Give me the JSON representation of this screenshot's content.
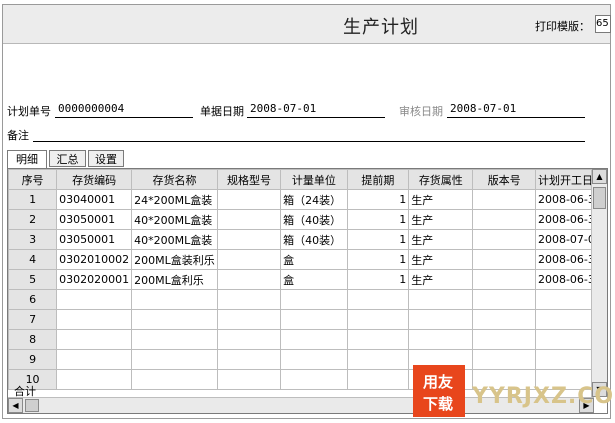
{
  "title": "生产计划",
  "print_template": {
    "label": "打印模版：",
    "value": "65"
  },
  "header": {
    "plan_no_label": "计划单号",
    "plan_no_value": "0000000004",
    "doc_date_label": "单据日期",
    "doc_date_value": "2008-07-01",
    "audit_date_label": "审核日期",
    "audit_date_value": "2008-07-01",
    "remark_label": "备注"
  },
  "tabs": [
    "明细",
    "汇总",
    "设置"
  ],
  "columns": [
    "序号",
    "存货编码",
    "存货名称",
    "规格型号",
    "计量单位",
    "提前期",
    "存货属性",
    "版本号",
    "计划开工日期"
  ],
  "rows": [
    {
      "no": "1",
      "code": "03040001",
      "name": "24*200ML盒装",
      "spec": "",
      "unit": "箱（24装）",
      "lead": "1",
      "attr": "生产",
      "ver": "",
      "date": "2008-06-30"
    },
    {
      "no": "2",
      "code": "03050001",
      "name": "40*200ML盒装",
      "spec": "",
      "unit": "箱（40装）",
      "lead": "1",
      "attr": "生产",
      "ver": "",
      "date": "2008-06-30"
    },
    {
      "no": "3",
      "code": "03050001",
      "name": "40*200ML盒装",
      "spec": "",
      "unit": "箱（40装）",
      "lead": "1",
      "attr": "生产",
      "ver": "",
      "date": "2008-07-01"
    },
    {
      "no": "4",
      "code": "0302010002",
      "name": "200ML盒装利乐",
      "spec": "",
      "unit": "盒",
      "lead": "1",
      "attr": "生产",
      "ver": "",
      "date": "2008-06-30"
    },
    {
      "no": "5",
      "code": "0302020001",
      "name": "200ML盒利乐",
      "spec": "",
      "unit": "盒",
      "lead": "1",
      "attr": "生产",
      "ver": "",
      "date": "2008-06-30"
    },
    {
      "no": "6",
      "code": "",
      "name": "",
      "spec": "",
      "unit": "",
      "lead": "",
      "attr": "",
      "ver": "",
      "date": ""
    },
    {
      "no": "7",
      "code": "",
      "name": "",
      "spec": "",
      "unit": "",
      "lead": "",
      "attr": "",
      "ver": "",
      "date": ""
    },
    {
      "no": "8",
      "code": "",
      "name": "",
      "spec": "",
      "unit": "",
      "lead": "",
      "attr": "",
      "ver": "",
      "date": ""
    },
    {
      "no": "9",
      "code": "",
      "name": "",
      "spec": "",
      "unit": "",
      "lead": "",
      "attr": "",
      "ver": "",
      "date": ""
    },
    {
      "no": "10",
      "code": "",
      "name": "",
      "spec": "",
      "unit": "",
      "lead": "",
      "attr": "",
      "ver": "",
      "date": ""
    }
  ],
  "total_label": "合计",
  "watermark": {
    "logo_top": "用友",
    "logo_bottom": "下载",
    "text": "YYRJXZ.COM"
  }
}
